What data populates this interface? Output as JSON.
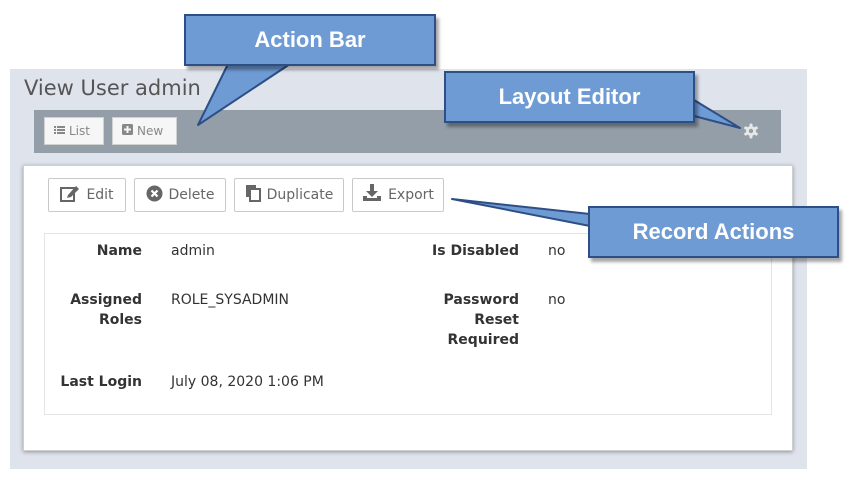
{
  "page": {
    "title": "View User admin"
  },
  "action_bar": {
    "list_label": "List",
    "new_label": "New",
    "settings_icon": "gear-icon"
  },
  "record_actions": {
    "edit_label": "Edit",
    "delete_label": "Delete",
    "duplicate_label": "Duplicate",
    "export_label": "Export"
  },
  "fields": {
    "name": {
      "label": "Name",
      "value": "admin"
    },
    "is_disabled": {
      "label": "Is Disabled",
      "value": "no"
    },
    "assigned_roles": {
      "label_line1": "Assigned",
      "label_line2": "Roles",
      "value": "ROLE_SYSADMIN"
    },
    "password_reset_required": {
      "label_line1": "Password",
      "label_line2": "Reset",
      "label_line3": "Required",
      "value": "no"
    },
    "last_login": {
      "label": "Last Login",
      "value": "July 08, 2020 1:06 PM"
    }
  },
  "callouts": {
    "action_bar": "Action Bar",
    "layout_editor": "Layout Editor",
    "record_actions": "Record Actions"
  },
  "colors": {
    "callout_fill": "#6f9bd4",
    "callout_border": "#2d4f86",
    "action_bar_bg": "#949ea9",
    "panel_bg": "#dfe3ec"
  }
}
